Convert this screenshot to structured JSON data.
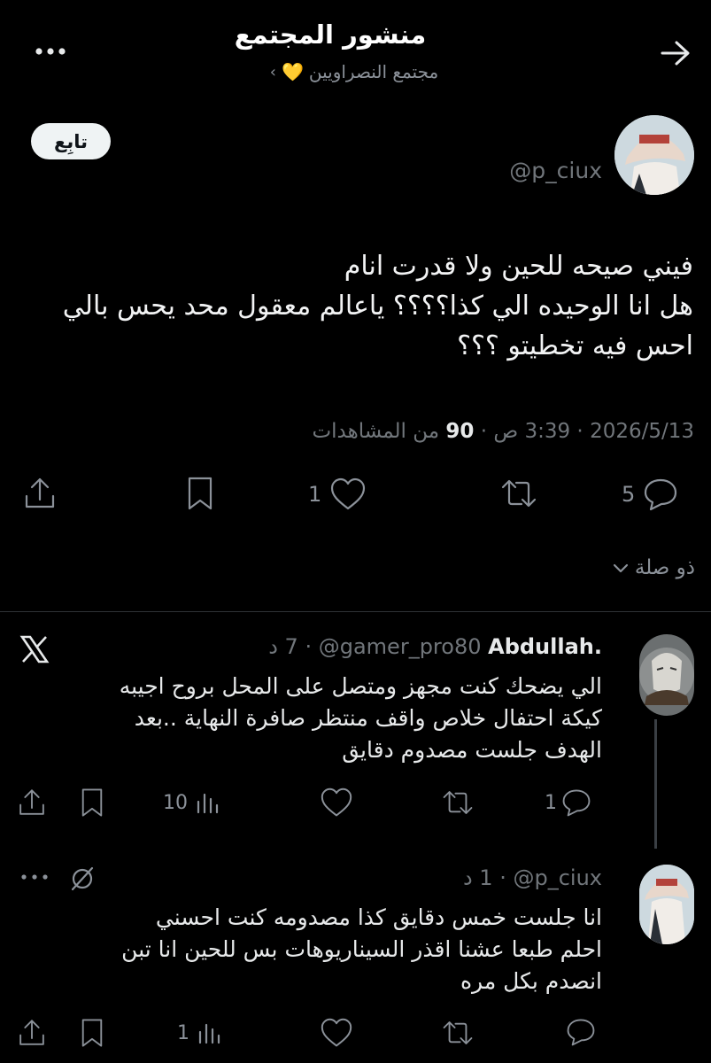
{
  "header": {
    "title": "منشور المجتمع",
    "community": "مجتمع النصراويين",
    "community_emoji": "💛",
    "more_icon": "more-icon",
    "back_icon": "arrow-back-icon"
  },
  "post": {
    "handle": "@p_ciux",
    "follow_label": "تابِع",
    "text_lines": [
      "فيني صيحه للحين ولا قدرت انام",
      "هل انا الوحيده الي كذا؟؟؟؟ ياعالم معقول محد يحس بالي",
      "احس فيه تخطيتو ؟؟؟"
    ],
    "date": "2026/5/13",
    "time": "3:39 ص",
    "views_count": "90",
    "views_label": "من المشاهدات",
    "replies": "5",
    "likes": "1"
  },
  "relevance": {
    "label": "ذو صلة"
  },
  "replies": [
    {
      "name": "Abdullah.",
      "handle": "@gamer_pro80",
      "time": "7 د",
      "lines": [
        "الي يضحك كنت مجهز ومتصل على المحل بروح اجيبه",
        "كيكة احتفال خلاص واقف منتظر صافرة النهاية ..بعد",
        "الهدف جلست مصدوم دقايق"
      ],
      "replies": "1",
      "views": "10"
    },
    {
      "handle": "@p_ciux",
      "time": "1 د",
      "lines": [
        "انا جلست خمس دقايق كذا مصدومه كنت احسني",
        "احلم طبعا عشنا اقذر السيناريوهات بس للحين انا تبن",
        "انصدم بكل مره"
      ],
      "views": "1"
    }
  ],
  "colors": {
    "background": "#000000",
    "text": "#e7e9ea",
    "muted": "#71767b",
    "divider": "#2f3336"
  }
}
